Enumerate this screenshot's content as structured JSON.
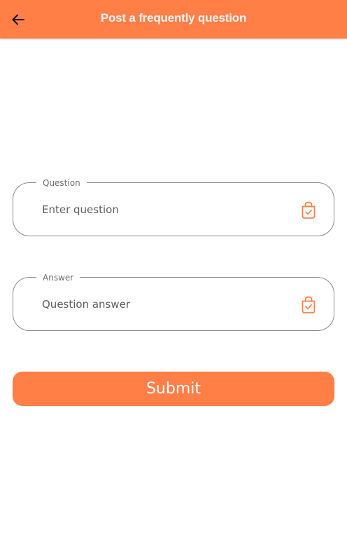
{
  "header": {
    "title": "Post a frequently question",
    "back_icon": "arrow-left-icon",
    "background": "#ff7f47"
  },
  "form": {
    "question": {
      "label": "Question",
      "placeholder": "Enter question",
      "icon": "bag-check-icon"
    },
    "answer": {
      "label": "Answer",
      "placeholder": "Question answer",
      "icon": "bag-check-icon"
    },
    "submit_label": "Submit"
  },
  "colors": {
    "accent": "#ff7f47",
    "border": "#8a8a8a"
  }
}
